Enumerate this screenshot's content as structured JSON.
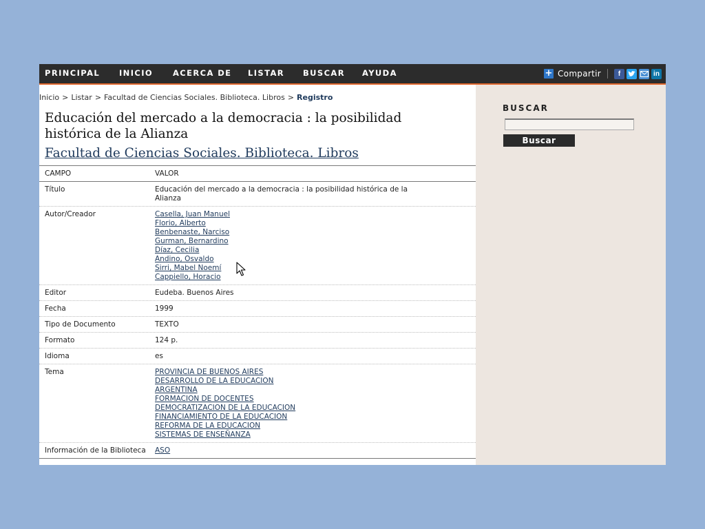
{
  "nav": {
    "items": [
      "PRINCIPAL",
      "INICIO",
      "ACERCA DE",
      "LISTAR",
      "BUSCAR",
      "AYUDA"
    ],
    "share_label": "Compartir",
    "share_icons": [
      "facebook-icon",
      "twitter-icon",
      "email-icon",
      "linkedin-icon"
    ]
  },
  "breadcrumb": {
    "items": [
      "Inicio",
      "Listar",
      "Facultad de Ciencias Sociales. Biblioteca. Libros"
    ],
    "current": "Registro",
    "separator": ">"
  },
  "record": {
    "title": "Educación del mercado a la democracia : la posibilidad histórica de la Alianza",
    "collection": "Facultad de Ciencias Sociales. Biblioteca. Libros"
  },
  "table": {
    "headers": [
      "CAMPO",
      "VALOR"
    ],
    "rows": [
      {
        "field": "Título",
        "values": [
          "Educación del mercado a la democracia : la posibilidad histórica de la",
          "Alianza"
        ],
        "links": false
      },
      {
        "field": "Autor/Creador",
        "values": [
          "Casella, Juan Manuel",
          "Florio, Alberto",
          "Benbenaste, Narciso",
          "Gurman, Bernardino",
          "Díaz, Cecilia",
          "Andino, Osvaldo",
          "Sirri, Mabel Noemí",
          "Cappiello, Horacio"
        ],
        "links": true
      },
      {
        "field": "Editor",
        "values": [
          "Eudeba. Buenos Aires"
        ],
        "links": false
      },
      {
        "field": "Fecha",
        "values": [
          "1999"
        ],
        "links": false
      },
      {
        "field": "Tipo de Documento",
        "values": [
          "TEXTO"
        ],
        "links": false
      },
      {
        "field": "Formato",
        "values": [
          "124 p."
        ],
        "links": false
      },
      {
        "field": "Idioma",
        "values": [
          "es"
        ],
        "links": false
      },
      {
        "field": "Tema",
        "values": [
          "PROVINCIA DE BUENOS AIRES",
          "DESARROLLO DE LA EDUCACION",
          "ARGENTINA",
          "FORMACION DE DOCENTES",
          "DEMOCRATIZACION DE LA EDUCACION",
          "FINANCIAMIENTO DE LA EDUCACION",
          "REFORMA DE LA EDUCACION",
          "SISTEMAS DE ENSEÑANZA"
        ],
        "links": true
      },
      {
        "field": "Información de la Biblioteca",
        "values": [
          "ASO"
        ],
        "links": true
      }
    ]
  },
  "sidebar": {
    "title": "BUSCAR",
    "search_value": "",
    "button_label": "Buscar"
  },
  "colors": {
    "nav_bg": "#2c2c2c",
    "nav_accent": "#e0662c",
    "link": "#1f3a5c",
    "sidebar_bg": "#ede6e0",
    "page_bg": "#95b2d8"
  }
}
